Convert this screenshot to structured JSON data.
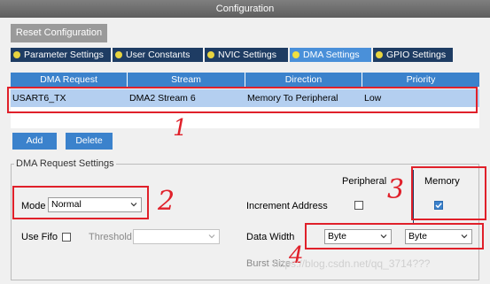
{
  "window": {
    "title": "Configuration"
  },
  "toolbar": {
    "reset_label": "Reset Configuration"
  },
  "tabs": [
    {
      "label": "Parameter Settings",
      "active": false
    },
    {
      "label": "User Constants",
      "active": false
    },
    {
      "label": "NVIC Settings",
      "active": false
    },
    {
      "label": "DMA Settings",
      "active": true
    },
    {
      "label": "GPIO Settings",
      "active": false
    }
  ],
  "dma_table": {
    "columns": [
      "DMA Request",
      "Stream",
      "Direction",
      "Priority"
    ],
    "rows": [
      {
        "request": "USART6_TX",
        "stream": "DMA2 Stream 6",
        "direction": "Memory To Peripheral",
        "priority": "Low"
      }
    ]
  },
  "buttons": {
    "add": "Add",
    "delete": "Delete"
  },
  "request_settings": {
    "group_title": "DMA Request Settings",
    "mode_label": "Mode",
    "mode_value": "Normal",
    "use_fifo_label": "Use Fifo",
    "use_fifo_checked": false,
    "threshold_label": "Threshold",
    "threshold_value": "",
    "peripheral_header": "Peripheral",
    "memory_header": "Memory",
    "increment_label": "Increment Address",
    "peripheral_increment": false,
    "memory_increment": true,
    "data_width_label": "Data Width",
    "peripheral_width": "Byte",
    "memory_width": "Byte",
    "burst_size_label": "Burst Size"
  },
  "annotations": {
    "n1": "1",
    "n2": "2",
    "n3": "3",
    "n4": "4"
  },
  "watermark": "https://blog.csdn.net/qq_3714???",
  "colors": {
    "accent": "#3b82cc",
    "highlight_row": "#b4cff0",
    "annotation_red": "#e0202a",
    "tab_dark": "#1e3c63"
  }
}
